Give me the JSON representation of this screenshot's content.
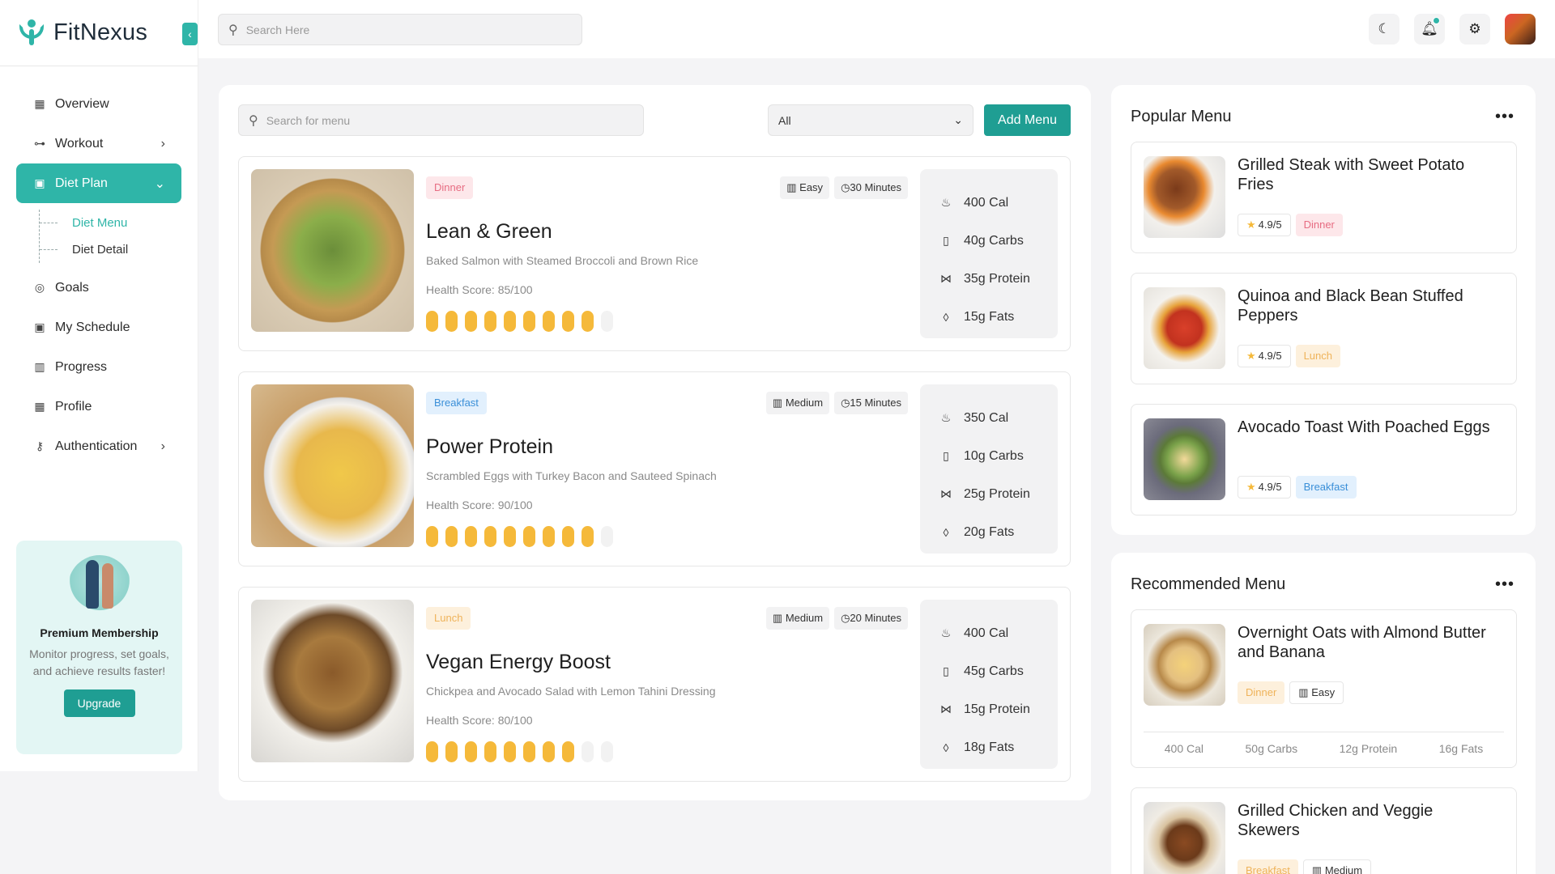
{
  "app": {
    "name": "FitNexus"
  },
  "topbar": {
    "search_placeholder": "Search Here"
  },
  "sidebar": {
    "items": [
      {
        "label": "Overview",
        "icon": "grid-icon"
      },
      {
        "label": "Workout",
        "icon": "dumbbell-icon",
        "has_chevron": true
      },
      {
        "label": "Diet Plan",
        "icon": "calendar-icon",
        "active": true,
        "expanded": true
      },
      {
        "label": "Goals",
        "icon": "target-icon"
      },
      {
        "label": "My Schedule",
        "icon": "calendar-icon"
      },
      {
        "label": "Progress",
        "icon": "chart-icon"
      },
      {
        "label": "Profile",
        "icon": "grid-icon"
      },
      {
        "label": "Authentication",
        "icon": "key-icon",
        "has_chevron": true
      }
    ],
    "sub_items": [
      {
        "label": "Diet Menu",
        "current": true
      },
      {
        "label": "Diet Detail"
      }
    ],
    "promo": {
      "title": "Premium Membership",
      "text": "Monitor progress, set goals, and achieve results faster!",
      "button": "Upgrade"
    }
  },
  "toolbar": {
    "search_placeholder": "Search for menu",
    "filter_value": "All",
    "add_label": "Add Menu"
  },
  "meals": [
    {
      "tag": "Dinner",
      "difficulty": "Easy",
      "time": "30 Minutes",
      "title": "Lean & Green",
      "desc": "Baked Salmon with Steamed Broccoli and Brown Rice",
      "score_label": "Health Score: 85/100",
      "score": 85,
      "cal": "400 Cal",
      "carbs": "40g Carbs",
      "protein": "35g Protein",
      "fats": "15g Fats"
    },
    {
      "tag": "Breakfast",
      "difficulty": "Medium",
      "time": "15 Minutes",
      "title": "Power Protein",
      "desc": "Scrambled Eggs with Turkey Bacon and Sauteed Spinach",
      "score_label": "Health Score: 90/100",
      "score": 90,
      "cal": "350 Cal",
      "carbs": "10g Carbs",
      "protein": "25g Protein",
      "fats": "20g Fats"
    },
    {
      "tag": "Lunch",
      "difficulty": "Medium",
      "time": "20 Minutes",
      "title": "Vegan Energy Boost",
      "desc": "Chickpea and Avocado Salad with Lemon Tahini Dressing",
      "score_label": "Health Score: 80/100",
      "score": 80,
      "cal": "400 Cal",
      "carbs": "45g Carbs",
      "protein": "15g Protein",
      "fats": "18g Fats"
    }
  ],
  "popular": {
    "title": "Popular Menu",
    "items": [
      {
        "name": "Grilled Steak with Sweet Potato Fries",
        "rating": "4.9/5",
        "tag": "Dinner"
      },
      {
        "name": "Quinoa and Black Bean Stuffed Peppers",
        "rating": "4.9/5",
        "tag": "Lunch"
      },
      {
        "name": "Avocado Toast With Poached Eggs",
        "rating": "4.9/5",
        "tag": "Breakfast"
      }
    ]
  },
  "recommended": {
    "title": "Recommended Menu",
    "items": [
      {
        "name": "Overnight Oats with Almond Butter and Banana",
        "tag": "Dinner",
        "difficulty": "Easy",
        "cal": "400 Cal",
        "carbs": "50g Carbs",
        "protein": "12g Protein",
        "fats": "16g Fats"
      },
      {
        "name": "Grilled Chicken and Veggie Skewers",
        "tag": "Breakfast",
        "difficulty": "Medium"
      }
    ]
  },
  "colors": {
    "accent": "#2fb5a8",
    "button": "#1f9e93",
    "score_bar": "#f5b93a"
  }
}
